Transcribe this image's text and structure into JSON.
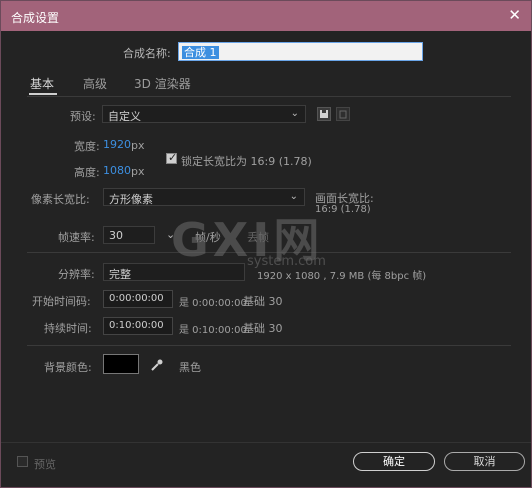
{
  "window": {
    "title": "合成设置",
    "close": "✕"
  },
  "comp_name": {
    "label": "合成名称:",
    "value": "合成 1"
  },
  "tabs": [
    {
      "label": "基本"
    },
    {
      "label": "高级"
    },
    {
      "label": "3D 渲染器"
    }
  ],
  "preset": {
    "label": "预设:",
    "value": "自定义"
  },
  "width": {
    "label": "宽度:",
    "value": "1920",
    "unit": "px"
  },
  "height": {
    "label": "高度:",
    "value": "1080",
    "unit": "px"
  },
  "lock": {
    "label": "锁定长宽比为 16:9 (1.78)",
    "checked": true
  },
  "pixel_aspect": {
    "label": "像素长宽比:",
    "value": "方形像素"
  },
  "frame_aspect": {
    "label": "画面长宽比:",
    "value": "16:9 (1.78)"
  },
  "frame_rate": {
    "label": "帧速率:",
    "value": "30",
    "unit": "帧/秒",
    "drop": "丢帧"
  },
  "resolution": {
    "label": "分辨率:",
    "value": "完整",
    "info": "1920 x 1080 , 7.9 MB (每 8bpc 帧)"
  },
  "start_timecode": {
    "label": "开始时间码:",
    "value": "0:00:00:00",
    "note": "是 0:00:00:00",
    "base": "基础 30"
  },
  "duration": {
    "label": "持续时间:",
    "value": "0:10:00:00",
    "note": "是 0:10:00:00",
    "base": "基础 30"
  },
  "background": {
    "label": "背景颜色:",
    "color": "#000000",
    "name": "黑色"
  },
  "preview": {
    "label": "预览"
  },
  "buttons": {
    "ok": "确定",
    "cancel": "取消"
  },
  "watermark": {
    "main": "GXI网",
    "sub": "system.com"
  },
  "colors": {
    "titlebar": "#a2637a",
    "accent_blue": "#3d8fe0"
  }
}
